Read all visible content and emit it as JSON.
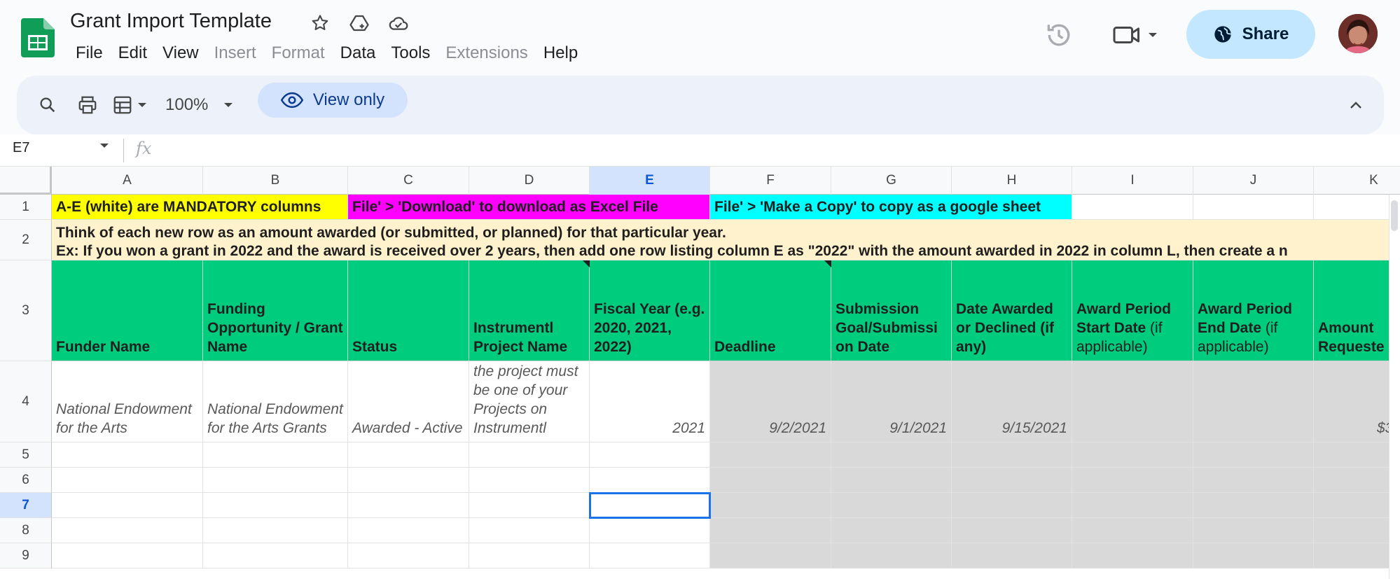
{
  "app": {
    "title": "Grant Import Template",
    "menu": [
      {
        "label": "File",
        "enabled": true
      },
      {
        "label": "Edit",
        "enabled": true
      },
      {
        "label": "View",
        "enabled": true
      },
      {
        "label": "Insert",
        "enabled": false
      },
      {
        "label": "Format",
        "enabled": false
      },
      {
        "label": "Data",
        "enabled": true
      },
      {
        "label": "Tools",
        "enabled": true
      },
      {
        "label": "Extensions",
        "enabled": false
      },
      {
        "label": "Help",
        "enabled": true
      }
    ],
    "share_label": "Share"
  },
  "toolbar": {
    "zoom": "100%",
    "view_only_label": "View only"
  },
  "formula_bar": {
    "cell_ref": "E7",
    "fx": "fx",
    "value": ""
  },
  "sheet": {
    "columns": [
      "A",
      "B",
      "C",
      "D",
      "E",
      "F",
      "G",
      "H",
      "I",
      "J",
      "K"
    ],
    "selected_column": "E",
    "rows": [
      "1",
      "2",
      "3",
      "4",
      "5",
      "6",
      "7",
      "8",
      "9"
    ],
    "selected_row": "7",
    "row1": {
      "a": "A-E (white) are MANDATORY columns",
      "c": "File' > 'Download' to download as Excel File",
      "f": "File' > 'Make a Copy' to copy as a google sheet"
    },
    "row2": {
      "line1": "Think of each new row as an amount awarded (or submitted, or planned) for that particular year.",
      "line2": "Ex: If you won a grant in 2022 and the award is received over 2 years, then add one row listing column E as \"2022\" with the amount awarded in 2022 in column L, then create a n"
    },
    "headers": {
      "a": "Funder Name",
      "b": "Funding Opportunity / Grant Name",
      "c": "Status",
      "d": "Instrumentl Project Name",
      "e": "Fiscal Year (e.g. 2020, 2021, 2022)",
      "f": "Deadline",
      "g": "Submission Goal/Submissi on Date",
      "h": "Date Awarded or Declined (if any)",
      "i_bold": "Award Period Start Date",
      "i_rest": " (if applicable)",
      "j_bold": "Award Period End Date",
      "j_rest": " (if applicable)",
      "k": "Amount Requeste"
    },
    "example": {
      "a": "National Endowment for the Arts",
      "b": "National Endowment for the Arts Grants",
      "c": "Awarded - Active",
      "d": "the project must be one of your Projects on Instrumentl",
      "e": "2021",
      "f": "9/2/2021",
      "g": "9/1/2021",
      "h": "9/15/2021",
      "k": "$3"
    }
  },
  "colors": {
    "row1_a": "#ffff00",
    "row1_c": "#ff00ff",
    "row1_f": "#00ffff",
    "header_green": "#00cc7e",
    "note_bg": "#fff2cc",
    "gray_area": "#d9d9d9",
    "share_bg": "#c2e7ff"
  }
}
